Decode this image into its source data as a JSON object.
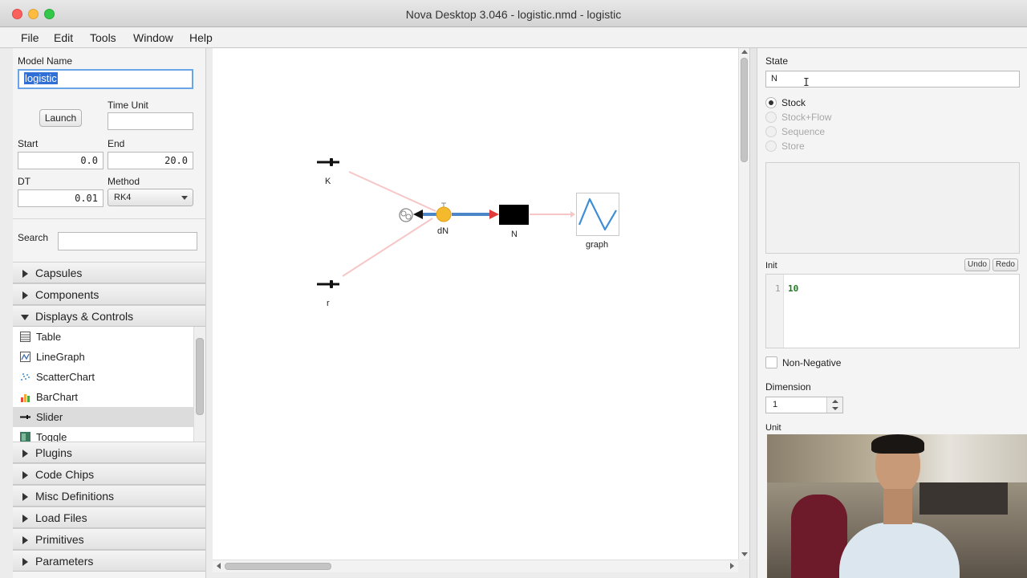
{
  "window": {
    "title": "Nova Desktop 3.046 - logistic.nmd - logistic"
  },
  "menu": [
    "File",
    "Edit",
    "Tools",
    "Window",
    "Help"
  ],
  "left": {
    "model_name_label": "Model Name",
    "model_name_value": "logistic",
    "launch_label": "Launch",
    "time_unit_label": "Time Unit",
    "time_unit_value": "",
    "start_label": "Start",
    "start_value": "0.0",
    "end_label": "End",
    "end_value": "20.0",
    "dt_label": "DT",
    "dt_value": "0.01",
    "method_label": "Method",
    "method_value": "RK4",
    "search_label": "Search",
    "search_value": "",
    "sections_top": [
      "Capsules",
      "Components"
    ],
    "open_section": "Displays & Controls",
    "list_items": [
      "Table",
      "LineGraph",
      "ScatterChart",
      "BarChart",
      "Slider",
      "Toggle"
    ],
    "selected_item": "Slider",
    "sections_bottom": [
      "Plugins",
      "Code Chips",
      "Misc Definitions",
      "Load Files",
      "Primitives",
      "Parameters"
    ]
  },
  "canvas": {
    "nodes": {
      "k": "K",
      "r": "r",
      "flow": "dN",
      "stock": "N",
      "graph": "graph"
    }
  },
  "right": {
    "state_label": "State",
    "state_value": "N",
    "radio_options": [
      "Stock",
      "Stock+Flow",
      "Sequence",
      "Store"
    ],
    "selected_option": "Stock",
    "init_label": "Init",
    "undo_label": "Undo",
    "redo_label": "Redo",
    "code_line_number": "1",
    "code_value": "10",
    "non_negative_label": "Non-Negative",
    "dimension_label": "Dimension",
    "dimension_value": "1",
    "unit_label": "Unit"
  },
  "colors": {
    "flow_pipe": "#4a86c8",
    "flow_valve": "#f5b92e",
    "stock": "#000000",
    "link": "#f7c6c6",
    "arrow_red": "#e23b3b",
    "graph_line": "#3d8ed4",
    "selection": "#2f6fd6"
  }
}
